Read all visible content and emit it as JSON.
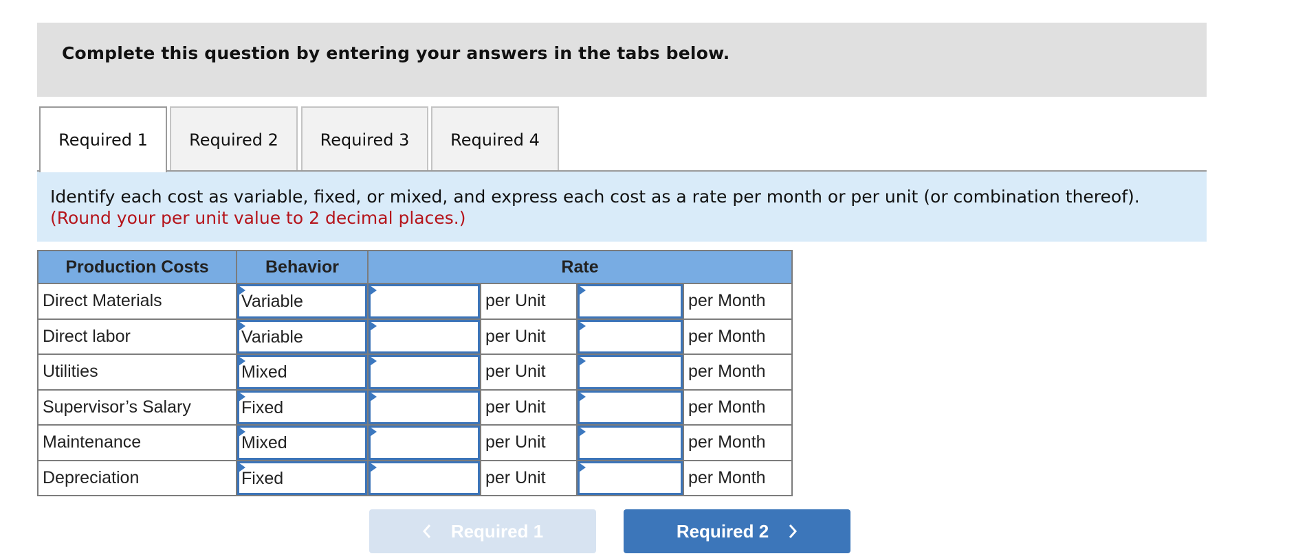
{
  "instructions": {
    "text": "Complete this question by entering your answers in the tabs below."
  },
  "tabs": [
    {
      "label": "Required 1",
      "active": true
    },
    {
      "label": "Required 2",
      "active": false
    },
    {
      "label": "Required 3",
      "active": false
    },
    {
      "label": "Required 4",
      "active": false
    }
  ],
  "prompt": {
    "text": "Identify each cost as variable, fixed, or mixed, and express each cost as a rate per month or per unit (or combination thereof).",
    "note": "(Round your per unit value to 2 decimal places.)"
  },
  "table": {
    "headers": {
      "production_costs": "Production Costs",
      "behavior": "Behavior",
      "rate": "Rate"
    },
    "rows": [
      {
        "cost": "Direct Materials",
        "behavior": "Variable",
        "per_unit_value": "",
        "per_unit_label": "per Unit",
        "per_month_value": "",
        "per_month_label": "per Month"
      },
      {
        "cost": "Direct labor",
        "behavior": "Variable",
        "per_unit_value": "",
        "per_unit_label": "per Unit",
        "per_month_value": "",
        "per_month_label": "per Month"
      },
      {
        "cost": "Utilities",
        "behavior": "Mixed",
        "per_unit_value": "",
        "per_unit_label": "per Unit",
        "per_month_value": "",
        "per_month_label": "per Month"
      },
      {
        "cost": "Supervisor’s Salary",
        "behavior": "Fixed",
        "per_unit_value": "",
        "per_unit_label": "per Unit",
        "per_month_value": "",
        "per_month_label": "per Month"
      },
      {
        "cost": "Maintenance",
        "behavior": "Mixed",
        "per_unit_value": "",
        "per_unit_label": "per Unit",
        "per_month_value": "",
        "per_month_label": "per Month"
      },
      {
        "cost": "Depreciation",
        "behavior": "Fixed",
        "per_unit_value": "",
        "per_unit_label": "per Unit",
        "per_month_value": "",
        "per_month_label": "per Month"
      }
    ]
  },
  "navigation": {
    "prev_label": "Required 1",
    "prev_icon": "chevron-left-icon",
    "prev_enabled": false,
    "next_label": "Required 2",
    "next_icon": "chevron-right-icon",
    "next_enabled": true
  },
  "colors": {
    "header_blue": "#78ace3",
    "input_border": "#3c74b8",
    "note_red": "#b5141b",
    "next_button": "#3c76ba",
    "prev_button_disabled": "#d7e3f1",
    "prompt_band": "#d9ebf9",
    "instructions_box": "#e0e0e0"
  }
}
